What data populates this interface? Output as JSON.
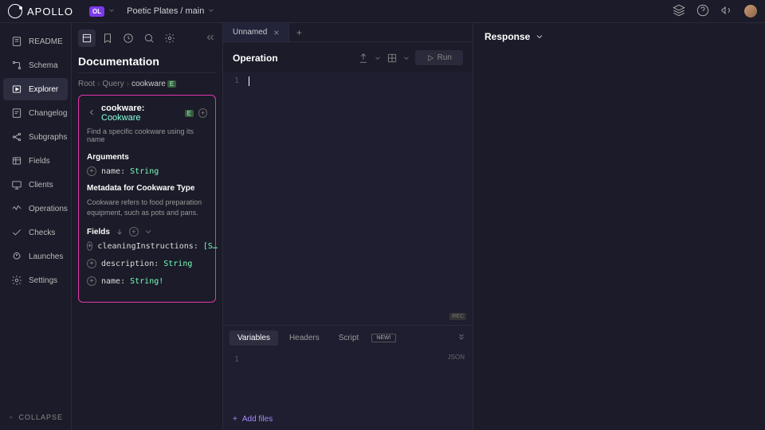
{
  "brand": "APOLLO",
  "org_badge": "OL",
  "project_crumb": "Poetic Plates / main",
  "sidebar": {
    "items": [
      {
        "label": "README"
      },
      {
        "label": "Schema"
      },
      {
        "label": "Explorer"
      },
      {
        "label": "Changelog"
      },
      {
        "label": "Subgraphs"
      },
      {
        "label": "Fields"
      },
      {
        "label": "Clients"
      },
      {
        "label": "Operations"
      },
      {
        "label": "Checks"
      },
      {
        "label": "Launches"
      },
      {
        "label": "Settings"
      }
    ],
    "collapse": "COLLAPSE"
  },
  "doc": {
    "title": "Documentation",
    "crumbs": {
      "root": "Root",
      "query": "Query",
      "current": "cookware"
    },
    "entity_badge": "E",
    "card": {
      "field_name": "cookware:",
      "field_type": "Cookware",
      "description": "Find a specific cookware using its name",
      "arguments_heading": "Arguments",
      "args": [
        {
          "name": "name:",
          "type": "String"
        }
      ],
      "metadata_heading": "Metadata for Cookware Type",
      "metadata_desc": "Cookware refers to food preparation equipment, such as pots and pans.",
      "fields_heading": "Fields",
      "fields": [
        {
          "name": "cleaningInstructions:",
          "type": "[S…"
        },
        {
          "name": "description:",
          "type": "String"
        },
        {
          "name": "name:",
          "type": "String!"
        }
      ]
    }
  },
  "tabs": {
    "active": "Unnamed"
  },
  "operation": {
    "title": "Operation",
    "run": "Run",
    "line1": "1",
    "rec": "REC"
  },
  "vars": {
    "tabs": {
      "variables": "Variables",
      "headers": "Headers",
      "script": "Script",
      "new": "NEW!"
    },
    "line1": "1",
    "json": "JSON",
    "add_files": "Add files"
  },
  "response": {
    "title": "Response"
  }
}
